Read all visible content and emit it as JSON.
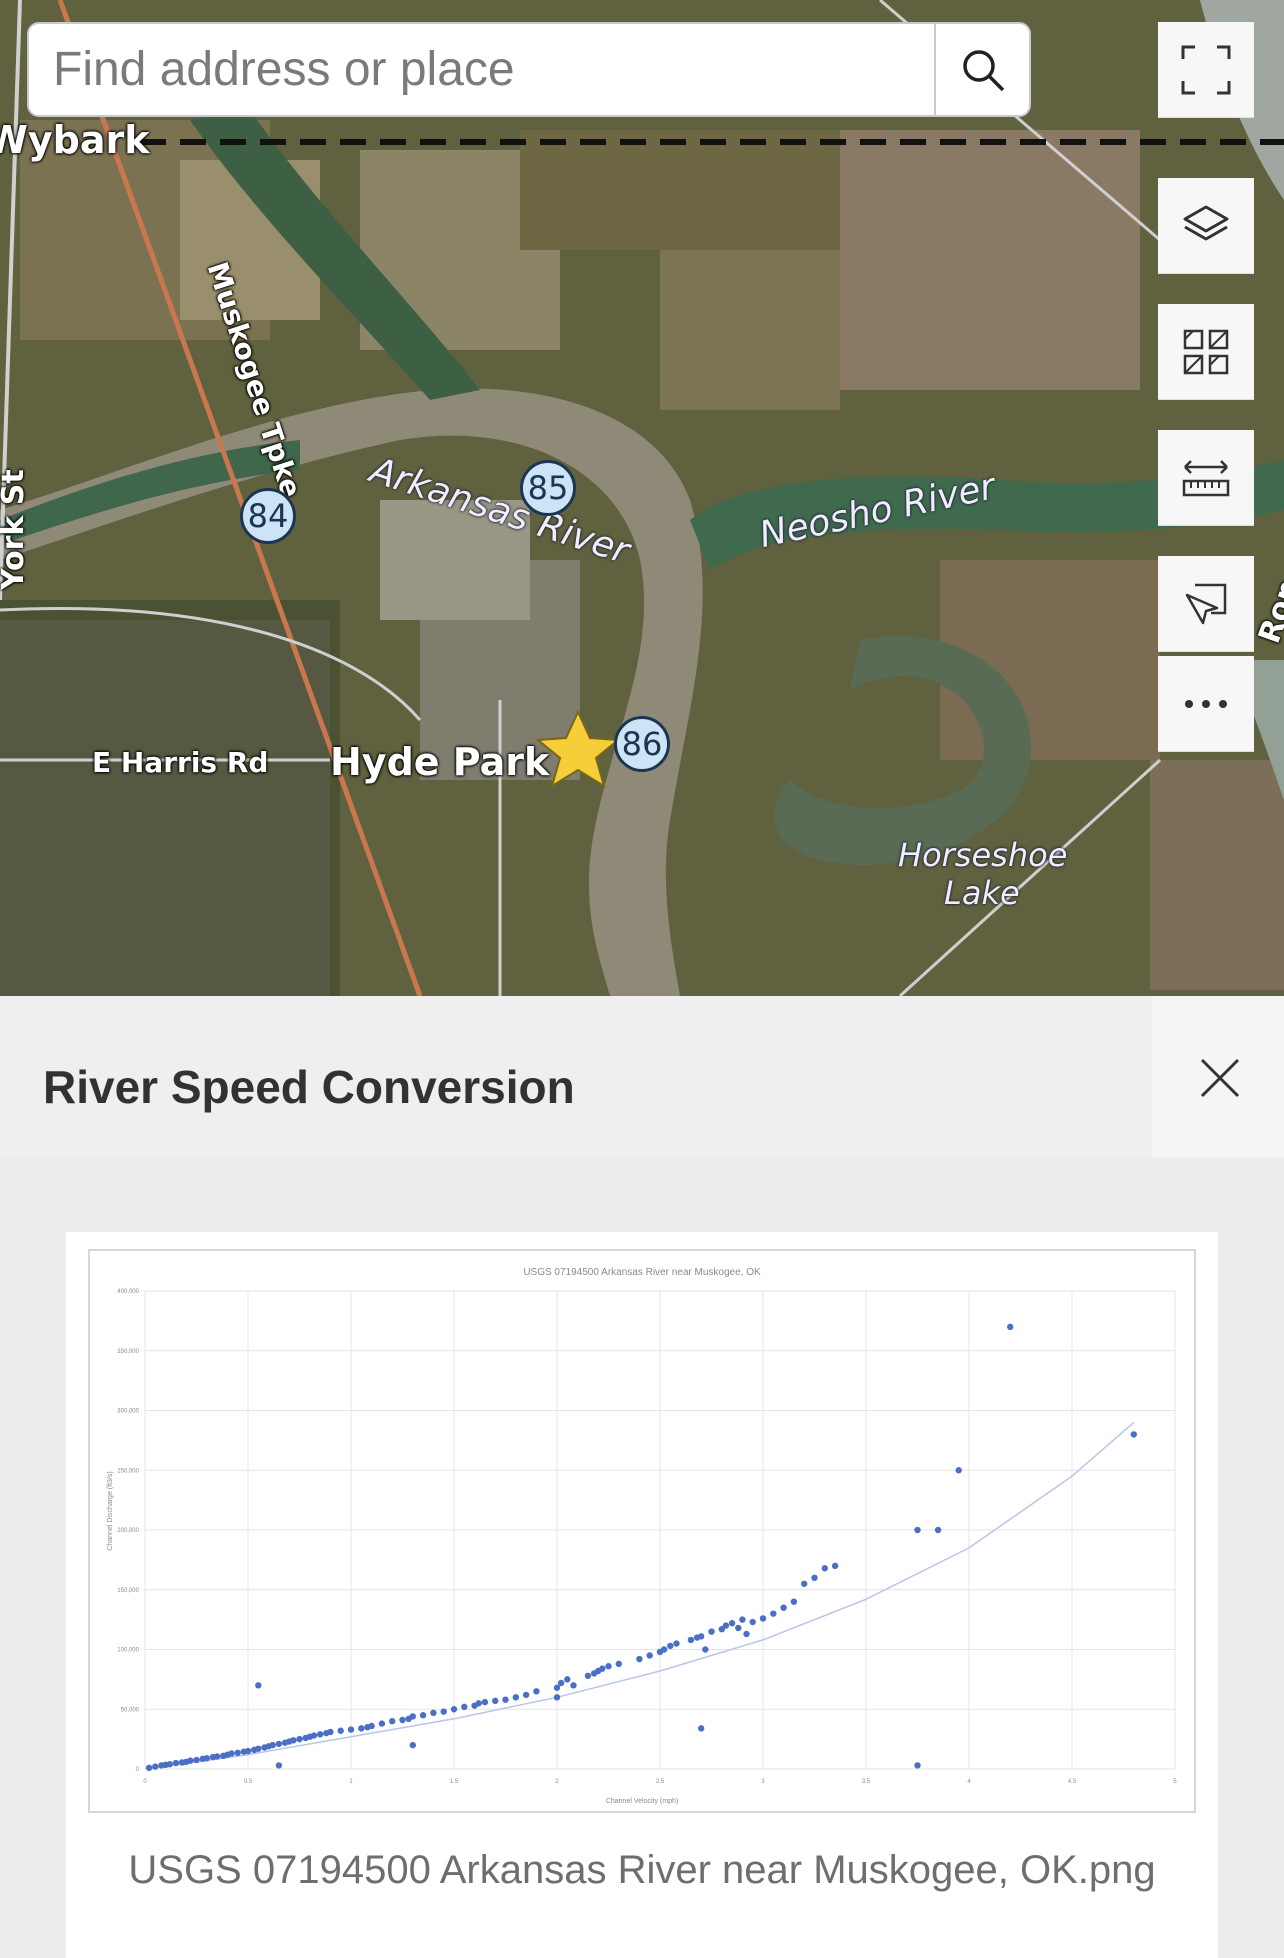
{
  "search": {
    "placeholder": "Find address or place"
  },
  "map": {
    "labels": {
      "wybark": "Wybark",
      "muskogee_tpke": "Muskogee Tpke",
      "arkansas_river": "Arkansas River",
      "neosho_river": "Neosho River",
      "e_harris_rd": "E Harris Rd",
      "hyde_park": "Hyde Park",
      "horseshoe_lake_1": "Horseshoe",
      "horseshoe_lake_2": "Lake",
      "york_st": "York St",
      "right_edge": "Rop"
    },
    "route_shields": [
      "84",
      "85",
      "86"
    ]
  },
  "toolbar": {
    "items": [
      {
        "icon": "fullscreen-icon"
      },
      {
        "icon": "layers-icon"
      },
      {
        "icon": "basemap-gallery-icon"
      },
      {
        "icon": "measure-icon"
      },
      {
        "icon": "select-icon"
      },
      {
        "icon": "more-icon"
      }
    ]
  },
  "panel": {
    "title": "River Speed Conversion",
    "caption": "USGS 07194500 Arkansas River near Muskogee, OK.png"
  },
  "chart_data": {
    "type": "scatter",
    "title": "USGS 07194500 Arkansas River near Muskogee, OK",
    "xlabel": "Channel Velocity (mph)",
    "ylabel": "Channel Discharge (ft3/s)",
    "xlim": [
      0,
      5
    ],
    "ylim": [
      0,
      400000
    ],
    "x_ticks": [
      "0",
      "0.5",
      "1",
      "1.5",
      "2",
      "2.5",
      "3",
      "3.5",
      "4",
      "4.5",
      "5"
    ],
    "y_ticks": [
      "0",
      "50,000",
      "100,000",
      "150,000",
      "200,000",
      "250,000",
      "300,000",
      "350,000",
      "400,000"
    ],
    "grid": true,
    "colors": {
      "points": "#4a6fc4",
      "trend": "#b7c6e6"
    },
    "trendline": {
      "x": [
        0,
        0.5,
        1,
        1.5,
        2,
        2.5,
        3,
        3.5,
        4,
        4.5,
        4.8
      ],
      "y": [
        0,
        12000,
        27000,
        42000,
        60000,
        82000,
        108000,
        142000,
        185000,
        245000,
        290000
      ]
    },
    "series": [
      {
        "x": [
          0.02,
          0.05,
          0.08,
          0.1,
          0.12,
          0.15,
          0.18,
          0.2,
          0.22,
          0.25,
          0.28,
          0.3,
          0.33,
          0.35,
          0.38,
          0.4,
          0.42,
          0.45,
          0.48,
          0.5,
          0.53,
          0.55,
          0.58,
          0.6,
          0.62,
          0.65,
          0.68,
          0.7,
          0.72,
          0.75,
          0.78,
          0.8,
          0.82,
          0.85,
          0.88,
          0.9,
          0.95,
          1.0,
          1.05,
          1.08,
          1.1,
          1.15,
          1.2,
          1.25,
          1.28,
          1.3,
          1.35,
          1.4,
          1.45,
          1.5,
          1.55,
          1.6,
          1.62,
          1.65,
          1.7,
          1.75,
          1.8,
          1.85,
          1.9,
          2.0,
          2.0,
          2.02,
          2.05,
          2.08,
          2.15,
          2.18,
          2.2,
          2.22,
          2.25,
          2.3,
          2.4,
          2.45,
          2.5,
          2.52,
          2.55,
          2.58,
          2.65,
          2.68,
          2.7,
          2.72,
          2.75,
          2.8,
          2.82,
          2.85,
          2.88,
          2.9,
          2.92,
          2.95,
          3.0,
          3.05,
          3.1,
          3.15,
          3.2,
          3.25,
          3.3,
          3.35,
          0.55,
          0.65,
          1.3,
          2.7,
          3.75,
          3.75,
          3.85,
          3.95,
          4.2,
          4.8
        ],
        "y": [
          1000,
          2000,
          3000,
          3500,
          4000,
          5000,
          5500,
          6000,
          7000,
          7500,
          8500,
          9000,
          10000,
          10500,
          11000,
          12000,
          13000,
          13500,
          14500,
          15000,
          16000,
          17000,
          18000,
          19000,
          20000,
          21000,
          22000,
          23000,
          24000,
          25000,
          26000,
          27000,
          28000,
          29000,
          30000,
          31000,
          32000,
          33000,
          34000,
          35000,
          36000,
          38000,
          40000,
          41000,
          42000,
          44000,
          45000,
          47000,
          48000,
          50000,
          52000,
          53000,
          55000,
          56000,
          57000,
          58000,
          60000,
          62000,
          65000,
          68000,
          60000,
          72000,
          75000,
          70000,
          78000,
          80000,
          82000,
          84000,
          86000,
          88000,
          92000,
          95000,
          98000,
          100000,
          103000,
          105000,
          108000,
          110000,
          111000,
          100000,
          115000,
          117000,
          120000,
          122000,
          118000,
          125000,
          113000,
          123000,
          126000,
          130000,
          135000,
          140000,
          155000,
          160000,
          168000,
          170000,
          70000,
          3000,
          20000,
          34000,
          3000,
          200000,
          200000,
          250000,
          370000,
          280000
        ]
      }
    ]
  }
}
